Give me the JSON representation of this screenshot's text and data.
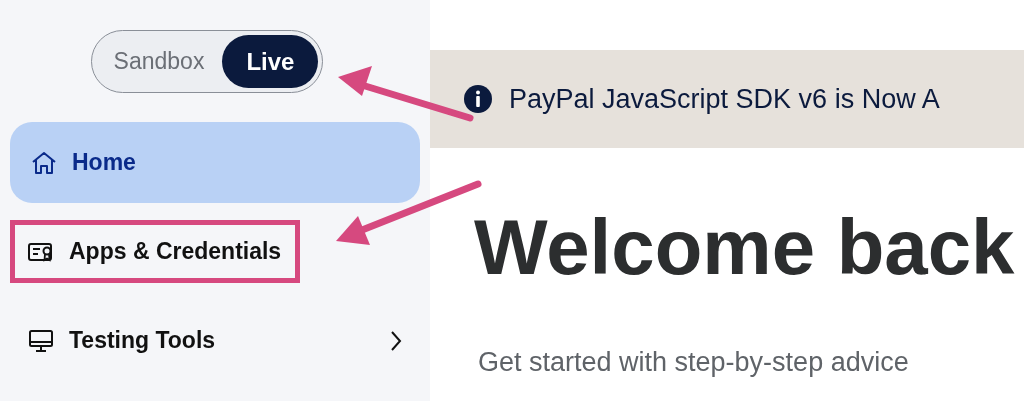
{
  "environment_toggle": [
    {
      "label": "Sandbox",
      "selected": false
    },
    {
      "label": "Live",
      "selected": true
    }
  ],
  "sidebar": {
    "items": [
      {
        "label": "Home",
        "selected": true,
        "highlighted": false,
        "has_submenu": false
      },
      {
        "label": "Apps & Credentials",
        "selected": false,
        "highlighted": true,
        "has_submenu": false
      },
      {
        "label": "Testing Tools",
        "selected": false,
        "highlighted": false,
        "has_submenu": true
      }
    ]
  },
  "banner": {
    "text": "PayPal JavaScript SDK v6 is Now A"
  },
  "heading": "Welcome back",
  "subtitle": "Get started with step-by-step advice"
}
